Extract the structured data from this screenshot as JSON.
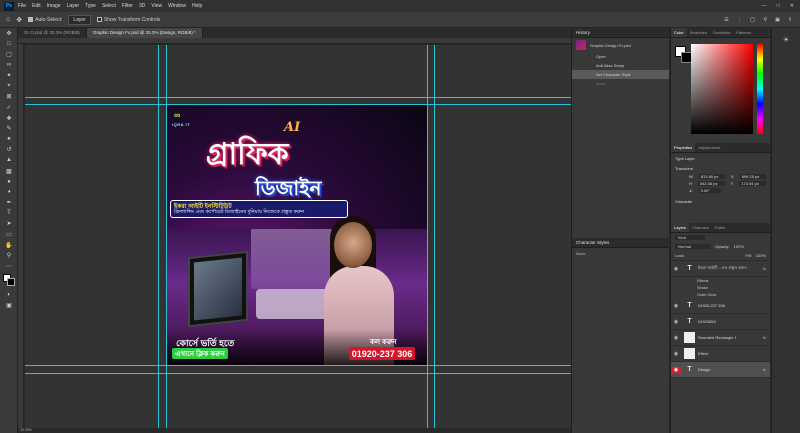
{
  "menubar": {
    "logo": "Ps",
    "items": [
      "File",
      "Edit",
      "Image",
      "Layer",
      "Type",
      "Select",
      "Filter",
      "3D",
      "View",
      "Window",
      "Help"
    ]
  },
  "options": {
    "auto_select_label": "Auto-Select:",
    "layer_select": "Layer",
    "show_transform_label": "Show Transform Controls"
  },
  "tabs": [
    {
      "label": "Gr O.psd @ 33.3% (RGB/8)",
      "active": false
    },
    {
      "label": "Graphic Design Fx.psd @ 33.3% (Design, RGB/8) *",
      "active": true
    }
  ],
  "artwork": {
    "logo_text": "IQRA IT",
    "ai_badge": "AI",
    "title_line1": "গ্রাফিক",
    "title_line2": "ডিজাইন",
    "subtitle_1": "ইকরা আইটি ইনস্টিটিউট",
    "subtitle_2": "ফ্রিল্যান্সিং এবং কর্পোরেট ডিজাইনের দুনিয়ায় নিজেকে প্রস্তুত করুন",
    "admit_label": "কোর্সে ভর্তি হতে",
    "admit_button": "এখানে ক্লিক করুন",
    "call_label": "কল করুন",
    "phone": "01920-237 306"
  },
  "status": "33.33%",
  "history": {
    "title": "History",
    "snapshot": "Graphic Design Fx.psd",
    "items": [
      {
        "label": "Open",
        "state": "normal"
      },
      {
        "label": "Anti Alias Sharp",
        "state": "normal"
      },
      {
        "label": "Set Character Style",
        "state": "active"
      },
      {
        "label": "Move",
        "state": "dim"
      }
    ]
  },
  "character_styles": {
    "title": "Character Styles",
    "item": "None"
  },
  "color_panel": {
    "tabs": [
      "Color",
      "Swatches",
      "Gradients",
      "Patterns"
    ]
  },
  "properties": {
    "tabs": [
      "Properties",
      "Adjustments"
    ],
    "layer_type": "Type Layer",
    "transform_label": "Transform",
    "w": "813.85 px",
    "x": "699.25 px",
    "h": "542.46 px",
    "y": "173.94 px",
    "angle": "0.00°",
    "character_label": "Character"
  },
  "layers": {
    "tabs": [
      "Layers",
      "Channels",
      "Paths"
    ],
    "filter": "Kind",
    "blend": "Normal",
    "opacity_label": "Opacity:",
    "opacity": "100%",
    "lock_label": "Lock:",
    "fill_label": "Fill:",
    "fill": "100%",
    "rows": [
      {
        "name": "ইকরা আইটি ...নত প্রস্তুত করুন",
        "thumb": "T",
        "fx": true,
        "selected": false
      },
      {
        "name": "01920-237 306",
        "thumb": "T",
        "fx": false,
        "selected": false
      },
      {
        "name": "01920854",
        "thumb": "T",
        "fx": false,
        "selected": false
      },
      {
        "name": "Rounded Rectangle 1",
        "thumb": "",
        "fx": true,
        "selected": false
      },
      {
        "name": "Effect",
        "thumb": "",
        "fx": false,
        "selected": false
      },
      {
        "name": "Design",
        "thumb": "T",
        "fx": true,
        "selected": true
      }
    ],
    "effects": [
      "Effects",
      "Stroke",
      "Outer Glow"
    ]
  },
  "colors": {
    "accent_guide": "#26c6da",
    "admit_green": "#2ecc40",
    "phone_red": "#d4162a"
  }
}
